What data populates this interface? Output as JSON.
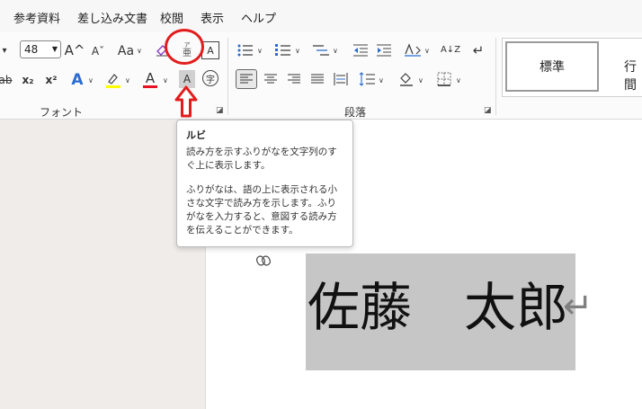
{
  "menu": [
    "参考資料",
    "差し込み文書",
    "校閲",
    "表示",
    "ヘルプ"
  ],
  "font_group": {
    "label": "フォント",
    "font_size": "48",
    "grow_label": "A^",
    "shrink_label": "Aˇ",
    "case_label": "Aa",
    "clear_format_label": "A",
    "subscript_label": "x₂",
    "superscript_label": "x²",
    "text_effect_label": "A",
    "highlight_label": "ab",
    "font_color_label": "A",
    "char_shade_label": "A",
    "enclose_label": "字",
    "ruby_label_top": "ア",
    "ruby_label_bottom": "亜",
    "border_char_label": "A"
  },
  "paragraph_group": {
    "label": "段落",
    "sort_label": "A↓Z"
  },
  "styles": {
    "normal": "標準",
    "next": "行間"
  },
  "tooltip": {
    "title": "ルビ",
    "para1": "読み方を示すふりがなを文字列のすぐ上に表示します。",
    "para2": "ふりがなは、語の上に表示される小さな文字で読み方を示します。ふりがなを入力すると、意図する読み方を伝えることができます。"
  },
  "document": {
    "text": "佐藤　太郎",
    "paragraph_mark": "↵"
  },
  "colors": {
    "annotation_red": "#e21c1c",
    "highlight_yellow": "#ffff00",
    "font_color_red": "#e81123",
    "selection_gray": "#c6c6c6"
  }
}
